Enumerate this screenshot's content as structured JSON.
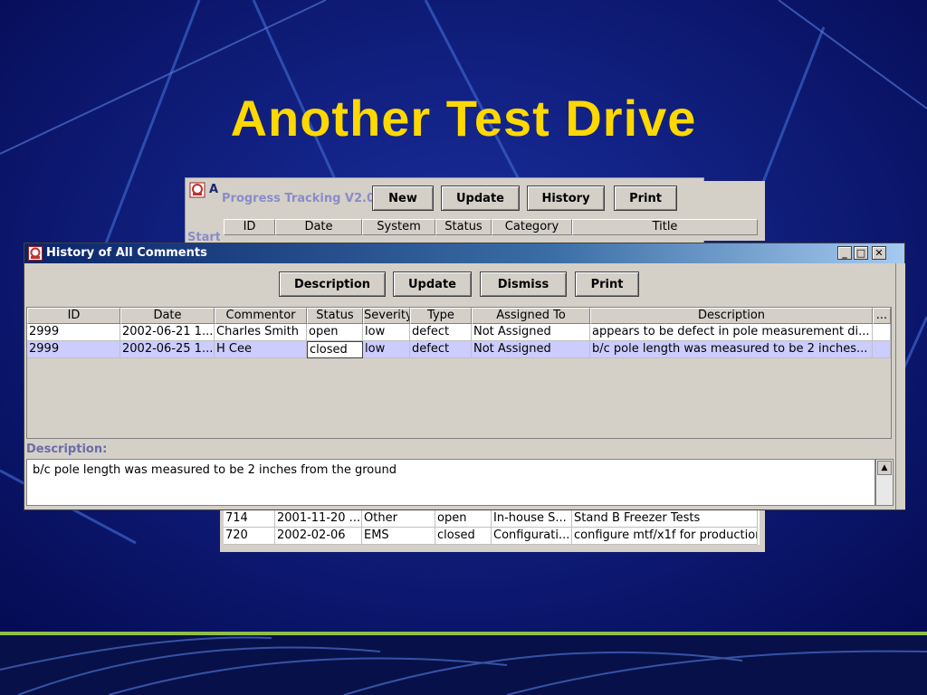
{
  "slide": {
    "title": "Another Test Drive"
  },
  "main_window": {
    "title_fragment": "A",
    "start_label": "Start",
    "app_name": "Progress Tracking V2.0",
    "buttons": [
      "New",
      "Update",
      "History",
      "Print"
    ],
    "columns": [
      "ID",
      "Date",
      "System",
      "Status",
      "Category",
      "Title"
    ],
    "rows": [
      [
        "714",
        "2001-11-20 ...",
        "Other",
        "open",
        "In-house S...",
        "Stand B Freezer Tests"
      ],
      [
        "720",
        "2002-02-06",
        "EMS",
        "closed",
        "Configurati...",
        "configure mtf/x1f for production"
      ]
    ]
  },
  "dialog": {
    "title": "History of All Comments",
    "buttons": [
      "Description",
      "Update",
      "Dismiss",
      "Print"
    ],
    "columns": [
      "ID",
      "Date",
      "Commentor",
      "Status",
      "Severity",
      "Type",
      "Assigned To",
      "Description",
      "..."
    ],
    "rows": [
      [
        "2999",
        "2002-06-21 1...",
        "Charles Smith",
        "open",
        "low",
        "defect",
        "Not Assigned",
        "appears to be defect in pole measurement di..."
      ],
      [
        "2999",
        "2002-06-25 1...",
        "H Cee",
        "closed",
        "low",
        "defect",
        "Not Assigned",
        "b/c pole length was measured to be 2 inches..."
      ]
    ],
    "selected_row": 1,
    "description_label": "Description:",
    "description_text": "b/c pole length was measured to be 2 inches from the ground"
  },
  "colors": {
    "background": "#0a1670",
    "title": "#ffd800",
    "selection": "#ccccff"
  }
}
